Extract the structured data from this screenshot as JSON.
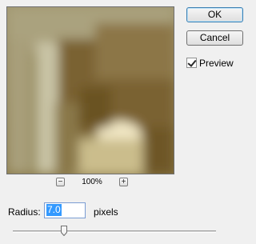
{
  "buttons": {
    "ok_label": "OK",
    "cancel_label": "Cancel"
  },
  "preview_toggle": {
    "label": "Preview",
    "checked": true
  },
  "zoom": {
    "out_symbol": "−",
    "level": "100%",
    "in_symbol": "+"
  },
  "radius": {
    "label": "Radius:",
    "value": "7.0",
    "units": "pixels"
  },
  "slider": {
    "value_fraction": 0.25
  },
  "icons": {
    "zoom_out": "zoom-out-icon",
    "zoom_in": "zoom-in-icon",
    "checkbox": "checkmark-icon",
    "slider_thumb": "slider-thumb-icon"
  },
  "colors": {
    "preview_base": "#8a7d52",
    "selection": "#3399ff",
    "default_button_border": "#3c7fb1"
  }
}
